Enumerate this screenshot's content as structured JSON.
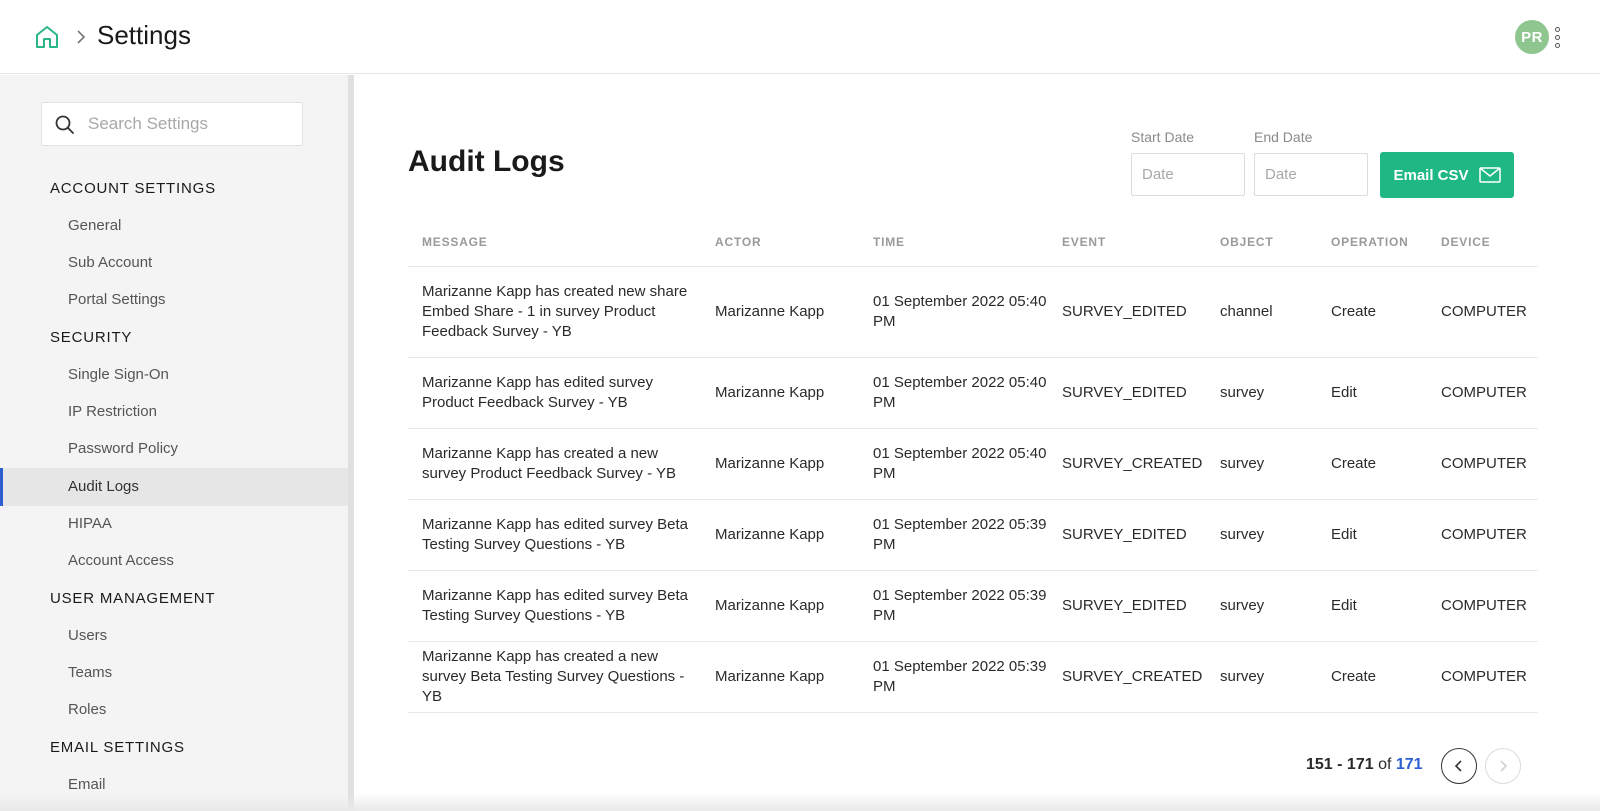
{
  "header": {
    "title": "Settings",
    "avatar_initials": "PR"
  },
  "sidebar": {
    "search_placeholder": "Search Settings",
    "sections": [
      {
        "title": "ACCOUNT SETTINGS",
        "items": [
          "General",
          "Sub Account",
          "Portal Settings"
        ]
      },
      {
        "title": "SECURITY",
        "items": [
          "Single Sign-On",
          "IP Restriction",
          "Password Policy",
          "Audit Logs",
          "HIPAA",
          "Account Access"
        ]
      },
      {
        "title": "USER MANAGEMENT",
        "items": [
          "Users",
          "Teams",
          "Roles"
        ]
      },
      {
        "title": "EMAIL SETTINGS",
        "items": [
          "Email"
        ]
      }
    ],
    "active_item": "Audit Logs"
  },
  "main": {
    "title": "Audit Logs",
    "start_date_label": "Start Date",
    "end_date_label": "End Date",
    "date_placeholder": "Date",
    "email_button": "Email CSV",
    "columns": [
      "MESSAGE",
      "ACTOR",
      "TIME",
      "EVENT",
      "OBJECT",
      "OPERATION",
      "DEVICE"
    ],
    "rows": [
      [
        "Marizanne Kapp has created new share Embed Share - 1 in survey Product Feedback Survey - YB",
        "Marizanne Kapp",
        "01 September 2022 05:40 PM",
        "SURVEY_EDITED",
        "channel",
        "Create",
        "COMPUTER"
      ],
      [
        "Marizanne Kapp has edited survey Product Feedback Survey - YB",
        "Marizanne Kapp",
        "01 September 2022 05:40 PM",
        "SURVEY_EDITED",
        "survey",
        "Edit",
        "COMPUTER"
      ],
      [
        "Marizanne Kapp has created a new survey Product Feedback Survey - YB",
        "Marizanne Kapp",
        "01 September 2022 05:40 PM",
        "SURVEY_CREATED",
        "survey",
        "Create",
        "COMPUTER"
      ],
      [
        "Marizanne Kapp has edited survey Beta Testing Survey Questions - YB",
        "Marizanne Kapp",
        "01 September 2022 05:39 PM",
        "SURVEY_EDITED",
        "survey",
        "Edit",
        "COMPUTER"
      ],
      [
        "Marizanne Kapp has edited survey Beta Testing Survey Questions - YB",
        "Marizanne Kapp",
        "01 September 2022 05:39 PM",
        "SURVEY_EDITED",
        "survey",
        "Edit",
        "COMPUTER"
      ],
      [
        "Marizanne Kapp has created a new survey Beta Testing Survey Questions - YB",
        "Marizanne Kapp",
        "01 September 2022 05:39 PM",
        "SURVEY_CREATED",
        "survey",
        "Create",
        "COMPUTER"
      ]
    ],
    "pagination": {
      "range": "151 - 171",
      "of": "of",
      "total": "171"
    }
  },
  "colors": {
    "accent": "#1fb884",
    "link": "#2d5fd3",
    "avatar": "#8fc68f",
    "home_icon": "#2bb58a"
  }
}
